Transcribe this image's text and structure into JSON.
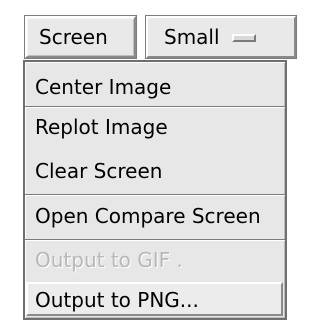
{
  "toolbar": {
    "screen_button": "Screen",
    "size_select_value": "Small"
  },
  "menu": {
    "items": [
      {
        "label": "Center Image",
        "enabled": true
      },
      {
        "label": "Replot Image",
        "enabled": true
      },
      {
        "label": "Clear Screen",
        "enabled": true
      },
      {
        "label": "Open Compare Screen",
        "enabled": true
      },
      {
        "label": "Output to GIF .",
        "enabled": false
      },
      {
        "label": "Output to PNG...",
        "enabled": true
      }
    ]
  },
  "icons": {
    "select_indicator": "dropdown-indicator-icon"
  }
}
